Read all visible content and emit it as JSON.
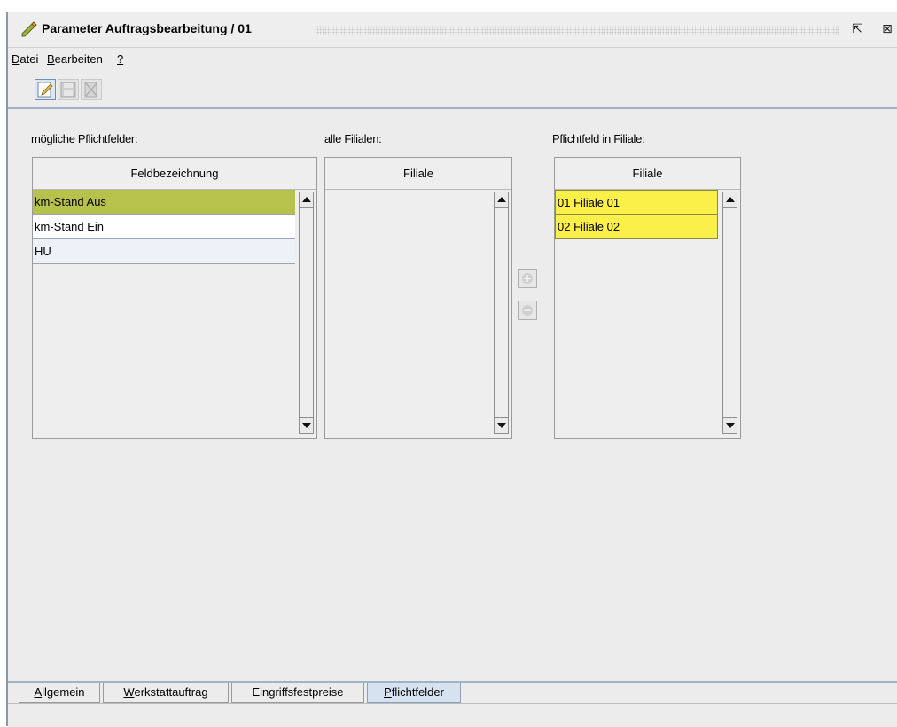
{
  "window": {
    "title": "Parameter Auftragsbearbeitung",
    "title_suffix": "/ 01",
    "minimize_glyph": "⇱",
    "close_glyph": "⊠"
  },
  "menu": [
    {
      "mnemonic": "D",
      "rest": "atei"
    },
    {
      "mnemonic": "B",
      "rest": "earbeiten"
    },
    {
      "mnemonic": "?",
      "rest": ""
    }
  ],
  "toolbar": {
    "icons": [
      "edit-icon",
      "save-icon",
      "delete-icon"
    ]
  },
  "panels": {
    "possible": {
      "label": "mögliche Pflichtfelder:",
      "header": "Feldbezeichnung",
      "rows": [
        "km-Stand Aus",
        "km-Stand Ein",
        "HU"
      ]
    },
    "all_branches": {
      "label": "alle Filialen:",
      "header": "Filiale",
      "rows": []
    },
    "required_in_branch": {
      "label": "Pflichtfeld in Filiale:",
      "header": "Filiale",
      "rows": [
        "01 Filiale 01",
        "02 Filiale 02"
      ]
    }
  },
  "move_buttons": {
    "add_glyph": "+",
    "remove_glyph": "−"
  },
  "tabs": [
    {
      "mnemonic": "A",
      "rest": "llgemein"
    },
    {
      "mnemonic": "W",
      "rest": "erkstattauftrag"
    },
    {
      "mnemonic": "",
      "rest": "Eingriffsfestpreise"
    },
    {
      "mnemonic": "P",
      "rest": "flichtfelder",
      "active": true
    }
  ],
  "colors": {
    "selected_row": "#b6c24c",
    "highlight_row": "#fbef4a",
    "active_tab": "#d6e2ef"
  }
}
